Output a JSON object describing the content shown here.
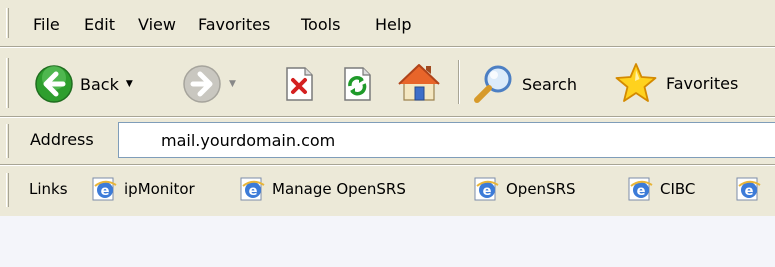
{
  "menu": {
    "items": [
      {
        "label": "File"
      },
      {
        "label": "Edit"
      },
      {
        "label": "View"
      },
      {
        "label": "Favorites"
      },
      {
        "label": "Tools"
      },
      {
        "label": "Help"
      }
    ]
  },
  "toolbar": {
    "back_label": "Back",
    "search_label": "Search",
    "favorites_label": "Favorites",
    "icons": [
      "back-arrow-icon",
      "forward-arrow-icon",
      "stop-icon",
      "refresh-icon",
      "home-icon",
      "search-magnifier-icon",
      "favorites-star-icon"
    ]
  },
  "address": {
    "label": "Address",
    "value": "mail.yourdomain.com"
  },
  "links": {
    "label": "Links",
    "items": [
      {
        "label": "ipMonitor"
      },
      {
        "label": "Manage OpenSRS"
      },
      {
        "label": "OpenSRS"
      },
      {
        "label": "CIBC"
      },
      {
        "label": ""
      }
    ]
  },
  "colors": {
    "chrome": "#ECE9D8",
    "back_green": "#2E9E2E",
    "content": "#F4F5FA"
  }
}
